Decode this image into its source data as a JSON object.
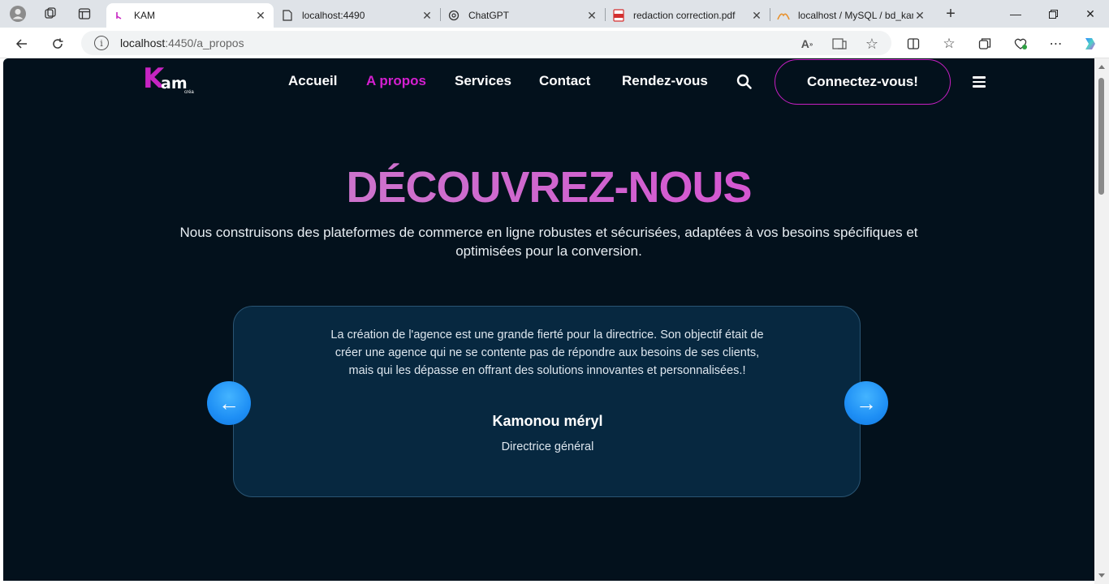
{
  "browser": {
    "tabs": [
      {
        "title": "KAM",
        "active": true
      },
      {
        "title": "localhost:4490",
        "active": false
      },
      {
        "title": "ChatGPT",
        "active": false
      },
      {
        "title": "redaction correction.pdf",
        "active": false
      },
      {
        "title": "localhost / MySQL / bd_kam",
        "active": false
      }
    ],
    "url_host": "localhost",
    "url_path": ":4450/a_propos"
  },
  "site": {
    "logo": {
      "mark": "K",
      "name": "am",
      "sub": "créa"
    },
    "nav": [
      {
        "label": "Accueil",
        "active": false
      },
      {
        "label": "A propos",
        "active": true
      },
      {
        "label": "Services",
        "active": false
      },
      {
        "label": "Contact",
        "active": false
      },
      {
        "label": "Rendez-vous",
        "active": false
      }
    ],
    "connect_label": "Connectez-vous!",
    "icons": {
      "search": "search-icon",
      "menu": "hamburger-menu-icon"
    }
  },
  "hero": {
    "title": "DÉCOUVREZ-NOUS",
    "subtitle": "Nous construisons des plateformes de commerce en ligne robustes et sécurisées, adaptées à vos besoins spécifiques et optimisées pour la conversion."
  },
  "testimonial": {
    "quote": "La création de l'agence est une grande fierté pour la directrice. Son objectif était de créer une agence qui ne se contente pas de répondre aux besoins de ses clients, mais qui les dépasse en offrant des solutions innovantes et personnalisées.!",
    "name": "Kamonou méryl",
    "role": "Directrice général",
    "prev_symbol": "←",
    "next_symbol": "→"
  },
  "colors": {
    "page_bg": "#03111c",
    "accent": "#d41fd0",
    "card_bg": "#072840",
    "arrow_blue": "#1e8ff5"
  }
}
